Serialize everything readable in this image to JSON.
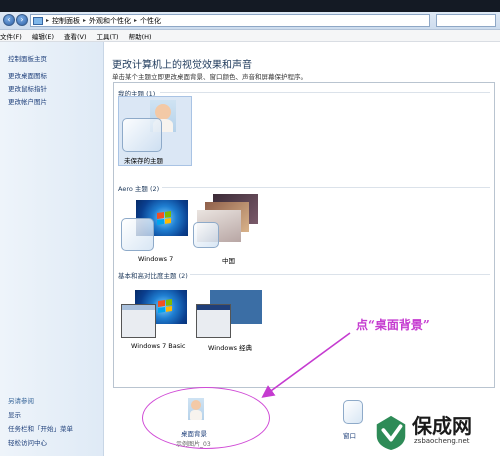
{
  "address_bar": {
    "crumbs": [
      "控制面板",
      "外观和个性化",
      "个性化"
    ]
  },
  "menu": [
    "文件(F)",
    "编辑(E)",
    "查看(V)",
    "工具(T)",
    "帮助(H)"
  ],
  "left_pane": {
    "links": [
      "控制面板主页",
      "更改桌面图标",
      "更改鼠标指针",
      "更改帐户图片"
    ],
    "see_also_title": "另请参阅",
    "see_also_links": [
      "显示",
      "任务栏和「开始」菜单",
      "轻松访问中心"
    ]
  },
  "main": {
    "title": "更改计算机上的视觉效果和声音",
    "subtitle": "单击某个主题立即更改桌面背景、窗口颜色、声音和屏幕保护程序。"
  },
  "themes": {
    "my_section": "我的主题 (1)",
    "my_themes": [
      {
        "name": "未保存的主题"
      }
    ],
    "aero_section": "Aero 主题 (2)",
    "aero_themes": [
      {
        "name": "Windows 7"
      },
      {
        "name": "中国"
      }
    ],
    "basic_section": "基本和高对比度主题 (2)",
    "basic_themes": [
      {
        "name": "Windows 7 Basic"
      },
      {
        "name": "Windows 经典"
      }
    ]
  },
  "bottom": {
    "desktop_bg_label": "桌面背景",
    "desktop_bg_sub": "示例图片_03",
    "window_color_label": "窗口"
  },
  "annotation": "点“桌面背景”",
  "watermark": {
    "title": "保成网",
    "url": "zsbaocheng.net"
  },
  "colors": {
    "accent": "#c53bd0",
    "link": "#1e3f7a",
    "title": "#1e395b"
  }
}
